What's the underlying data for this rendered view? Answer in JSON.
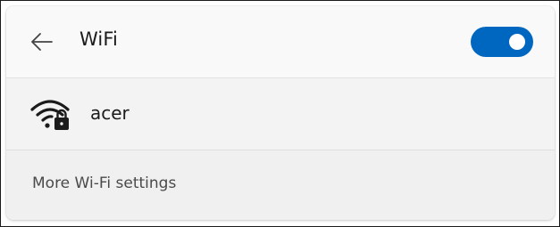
{
  "header": {
    "title": "WiFi",
    "back_icon": "arrow-left-icon",
    "toggle_state": "on"
  },
  "network": {
    "name": "acer",
    "icon": "wifi-secured-icon"
  },
  "more_settings": {
    "label": "More Wi-Fi settings"
  },
  "colors": {
    "accent": "#0067c0",
    "panel_bg": "#f3f3f3",
    "header_bg": "#f9f9f9",
    "text": "#1b1b1b",
    "secondary_text": "#4a4a4a"
  }
}
